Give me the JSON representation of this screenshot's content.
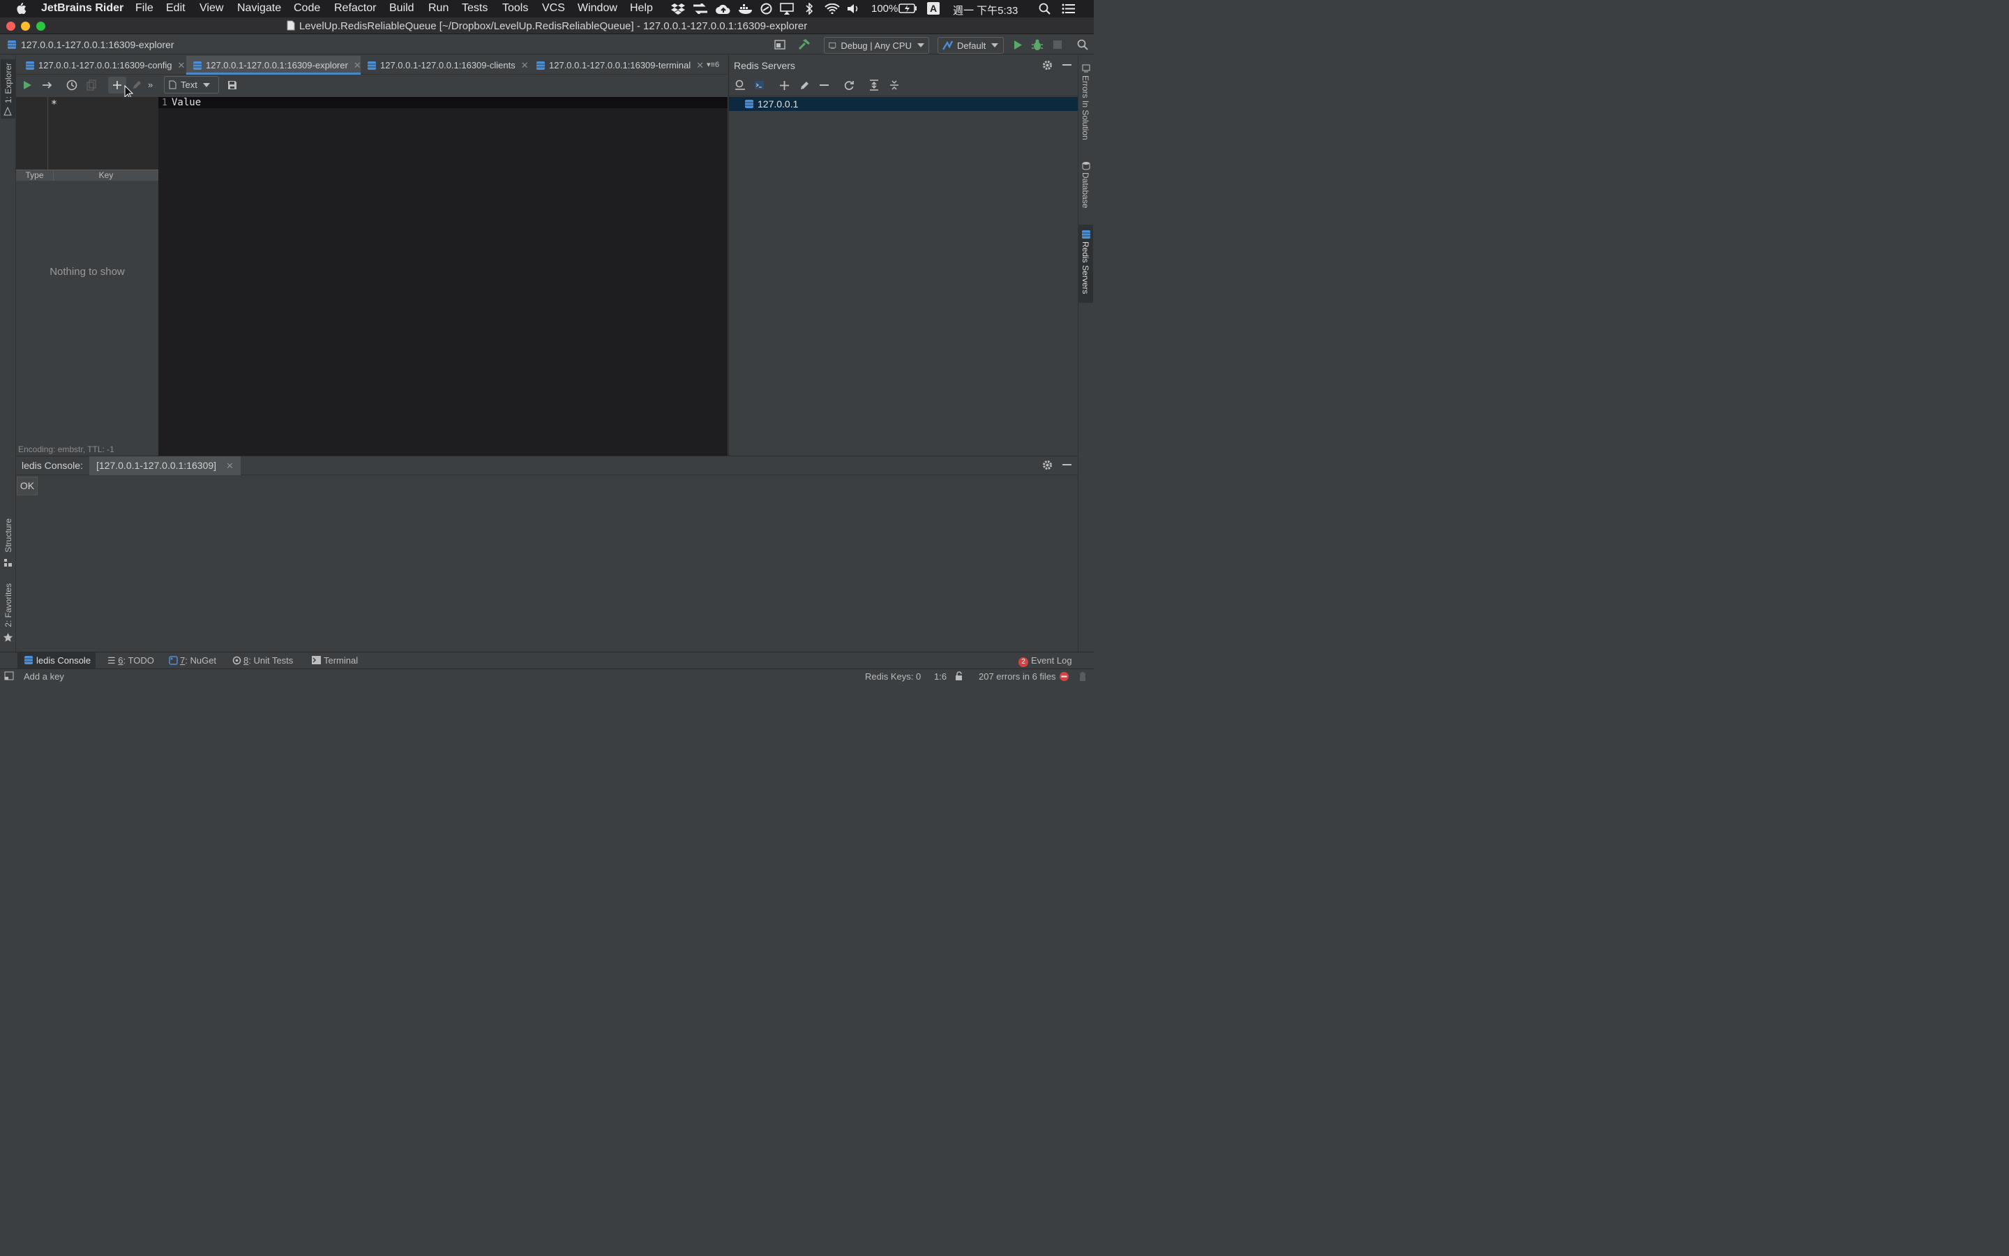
{
  "menubar": {
    "app_name": "JetBrains Rider",
    "items": [
      "File",
      "Edit",
      "View",
      "Navigate",
      "Code",
      "Refactor",
      "Build",
      "Run",
      "Tests",
      "Tools",
      "VCS",
      "Window",
      "Help"
    ],
    "battery": "100%",
    "input_method": "A",
    "clock": "週一 下午5:33"
  },
  "window": {
    "title": "LevelUp.RedisReliableQueue [~/Dropbox/LevelUp.RedisReliableQueue] - 127.0.0.1-127.0.0.1:16309-explorer"
  },
  "navbar": {
    "breadcrumb": "127.0.0.1-127.0.0.1:16309-explorer",
    "run_config": "Debug | Any CPU",
    "profile": "Default"
  },
  "left_tool_tabs": {
    "explorer": "1: Explorer",
    "structure": "Structure",
    "favorites": "2: Favorites"
  },
  "right_tool_tabs": {
    "errors": "Errors In Solution",
    "database": "Database",
    "redis_servers": "Redis Servers"
  },
  "editor_tabs": [
    {
      "label": "127.0.0.1-127.0.0.1:16309-config"
    },
    {
      "label": "127.0.0.1-127.0.0.1:16309-explorer"
    },
    {
      "label": "127.0.0.1-127.0.0.1:16309-clients"
    },
    {
      "label": "127.0.0.1-127.0.0.1:16309-terminal"
    }
  ],
  "tabs_overflow_count": "6",
  "explorer": {
    "format_select": "Text",
    "filter_pattern": "*",
    "col_type": "Type",
    "col_key": "Key",
    "empty_text": "Nothing to show",
    "encoding_info": "Encoding: embstr, TTL: -1",
    "value_line_number": "1",
    "value_text": "Value"
  },
  "redis_servers": {
    "title": "Redis Servers",
    "servers": [
      "127.0.0.1"
    ]
  },
  "console": {
    "title": "ledis Console:",
    "tab_label": "[127.0.0.1-127.0.0.1:16309]",
    "output": "OK"
  },
  "bottom_tabs": {
    "console": "ledis Console",
    "todo_num": "6",
    "todo_label": ": TODO",
    "nuget_num": "7",
    "nuget_label": ": NuGet",
    "tests_num": "8",
    "tests_label": ": Unit Tests",
    "terminal": "Terminal",
    "event_log_count": "2",
    "event_log": "Event Log"
  },
  "status": {
    "hint": "Add a key",
    "redis_keys": "Redis Keys: 0",
    "caret_position": "1:6",
    "errors": "207 errors in 6 files"
  },
  "colors": {
    "accent_blue": "#4a8fd9",
    "run_green": "#59a869",
    "error_red": "#d64242",
    "selection": "#0d293e"
  }
}
